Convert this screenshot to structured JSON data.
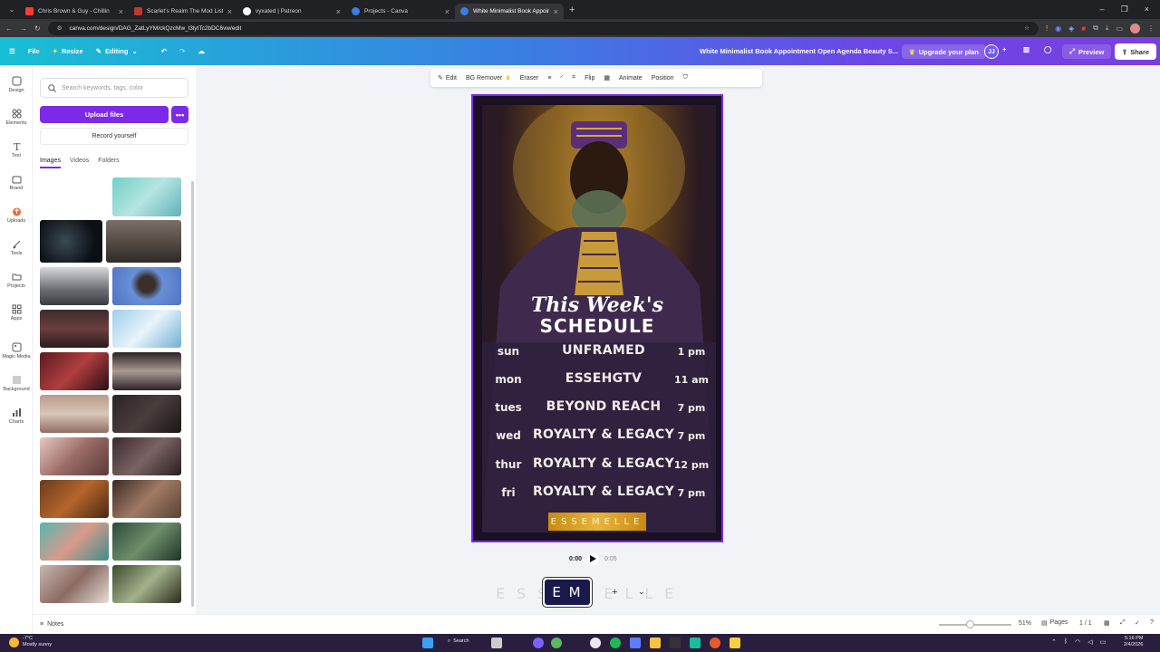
{
  "browser": {
    "tabs": [
      {
        "title": "Chris Brown & Guy - Chillin",
        "favicon_color": "#ff3b30"
      },
      {
        "title": "Scarlet's Realm The Mod List [S",
        "favicon_color": "#c0392b"
      },
      {
        "title": "vyxated | Patreon",
        "favicon_color": "#ffffff"
      },
      {
        "title": "Projects - Canva",
        "favicon_color": "#3a7ee2"
      },
      {
        "title": "White Minimalist Book Appoin",
        "favicon_color": "#3a7ee2"
      }
    ],
    "url": "canva.com/design/DAG_ZatLyYM/ckQzcMw_l3lytTc2bDC6vw/edit"
  },
  "header": {
    "file": "File",
    "resize": "Resize",
    "editing": "Editing",
    "doc_title": "White Minimalist Book Appointment Open Agenda Beauty S...",
    "upgrade": "Upgrade your plan",
    "avatar": "JJ",
    "preview": "Preview",
    "share": "Share"
  },
  "rail": [
    {
      "label": "Design",
      "icon": "design-icon"
    },
    {
      "label": "Elements",
      "icon": "elements-icon"
    },
    {
      "label": "Text",
      "icon": "text-icon"
    },
    {
      "label": "Brand",
      "icon": "brand-icon"
    },
    {
      "label": "Uploads",
      "icon": "uploads-icon"
    },
    {
      "label": "Tools",
      "icon": "tools-icon"
    },
    {
      "label": "Projects",
      "icon": "projects-icon"
    },
    {
      "label": "Apps",
      "icon": "apps-icon"
    },
    {
      "label": "Magic Media",
      "icon": "magic-media-icon"
    },
    {
      "label": "Background",
      "icon": "background-icon"
    },
    {
      "label": "Charts",
      "icon": "charts-icon"
    }
  ],
  "panel": {
    "search_placeholder": "Search keywords, tags, color",
    "upload": "Upload files",
    "more": "•••",
    "record": "Record yourself",
    "tabs": [
      "Images",
      "Videos",
      "Folders"
    ]
  },
  "toolbar": {
    "edit": "Edit",
    "bg_remover": "BG Remover",
    "eraser": "Eraser",
    "flip": "Flip",
    "animate": "Animate",
    "position": "Position"
  },
  "poster": {
    "title_line1": "This Week's",
    "title_line2": "SCHEDULE",
    "schedule": [
      {
        "day": "sun",
        "show": "UNFRAMED",
        "time": "1 pm"
      },
      {
        "day": "mon",
        "show": "ESSEHGTV",
        "time": "11 am"
      },
      {
        "day": "tues",
        "show": "BEYOND REACH",
        "time": "7 pm"
      },
      {
        "day": "wed",
        "show": "ROYALTY & LEGACY",
        "time": "7 pm"
      },
      {
        "day": "thur",
        "show": "ROYALTY & LEGACY",
        "time": "12 pm"
      },
      {
        "day": "fri",
        "show": "ROYALTY & LEGACY",
        "time": "7 pm"
      }
    ],
    "brand": "ESSEMELLE"
  },
  "playback": {
    "current": "0:00",
    "duration": "0:05"
  },
  "timeline": {
    "clip_text": "E M",
    "ghost_text": "ESSEMELLE"
  },
  "footer": {
    "notes": "Notes",
    "zoom": "51%",
    "pages": "Pages",
    "page_count": "1 / 1"
  },
  "taskbar": {
    "weather_temp": "-7°C",
    "weather_desc": "Mostly sunny",
    "search": "Search",
    "time": "5:16 PM",
    "date": "2/4/2026"
  }
}
